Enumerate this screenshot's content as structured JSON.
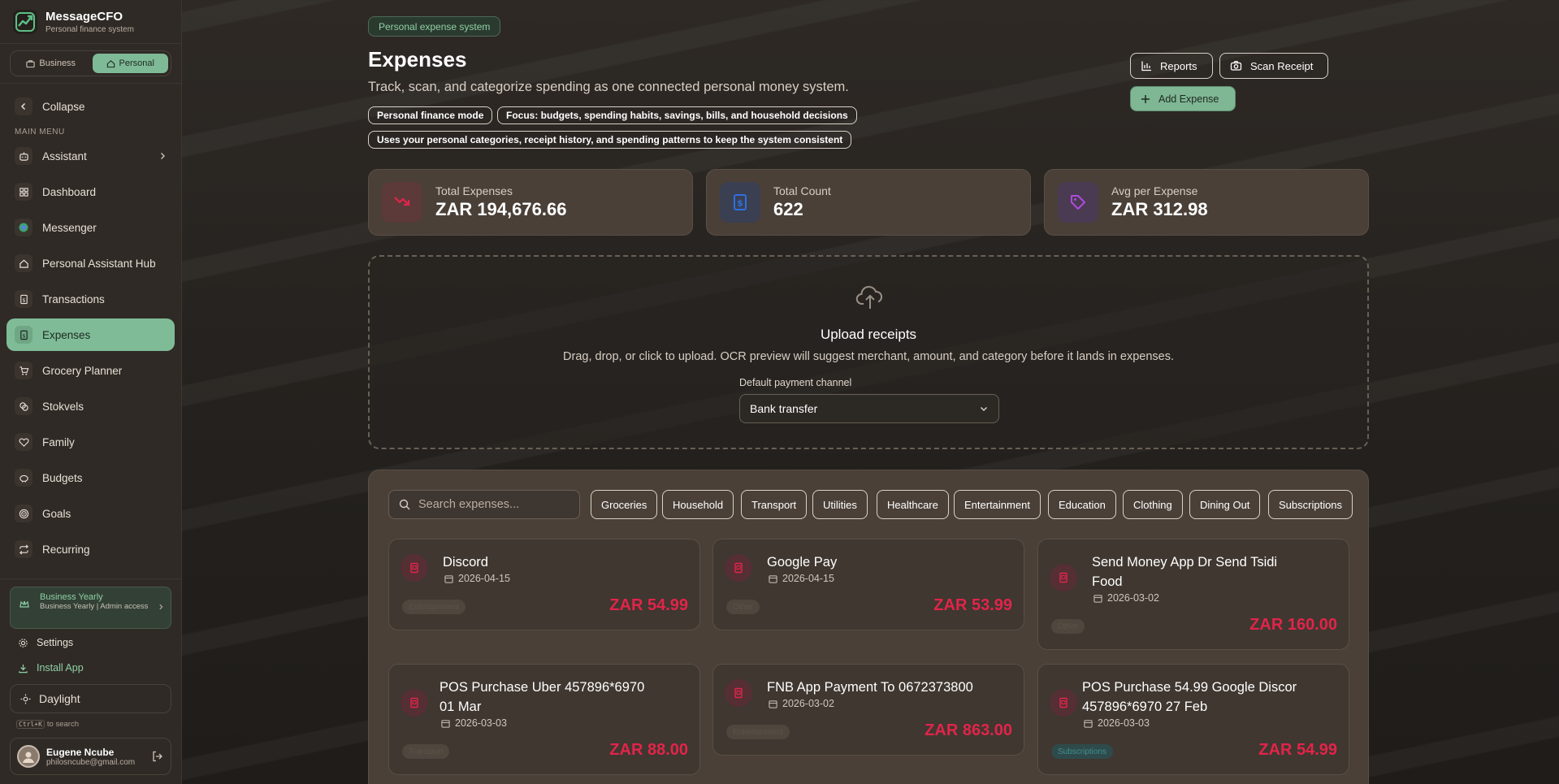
{
  "brand": {
    "name": "MessageCFO",
    "tagline": "Personal finance system"
  },
  "mode_toggle": {
    "business": "Business",
    "personal": "Personal",
    "active": "personal"
  },
  "sidebar": {
    "collapse": "Collapse",
    "menu_label": "MAIN MENU",
    "items": [
      {
        "label": "Assistant",
        "icon": "bot-icon"
      },
      {
        "label": "Dashboard",
        "icon": "grid-icon"
      },
      {
        "label": "Messenger",
        "icon": "whatsapp-icon"
      },
      {
        "label": "Personal Assistant Hub",
        "icon": "home-icon"
      },
      {
        "label": "Transactions",
        "icon": "receipt-icon"
      },
      {
        "label": "Expenses",
        "icon": "dollar-receipt-icon"
      },
      {
        "label": "Grocery Planner",
        "icon": "cart-icon"
      },
      {
        "label": "Stokvels",
        "icon": "coins-icon"
      },
      {
        "label": "Family",
        "icon": "heart-icon"
      },
      {
        "label": "Budgets",
        "icon": "piggy-bank-icon"
      },
      {
        "label": "Goals",
        "icon": "target-icon"
      },
      {
        "label": "Recurring",
        "icon": "repeat-icon"
      }
    ],
    "active_item": "Expenses",
    "plan": {
      "title": "Business Yearly",
      "subtitle": "Business Yearly | Admin access"
    },
    "settings": "Settings",
    "install": "Install App",
    "theme": "Daylight",
    "shortcut_key": "Ctrl+K",
    "shortcut_text": "to search",
    "user": {
      "name": "Eugene Ncube",
      "email": "philosncube@gmail.com"
    }
  },
  "header": {
    "system_pill": "Personal expense system",
    "title": "Expenses",
    "subtitle": "Track, scan, and categorize spending as one connected personal money system.",
    "tags": [
      "Personal finance mode",
      "Focus: budgets, spending habits, savings, bills, and household decisions",
      "Uses your personal categories, receipt history, and spending patterns to keep the system consistent"
    ],
    "reports_button": "Reports",
    "scan_button": "Scan Receipt",
    "add_button": "Add Expense"
  },
  "stats": [
    {
      "label": "Total Expenses",
      "value": "ZAR 194,676.66",
      "color": "#e2244a"
    },
    {
      "label": "Total Count",
      "value": "622",
      "color": "#2f6fe0"
    },
    {
      "label": "Avg per Expense",
      "value": "ZAR 312.98",
      "color": "#b04adf"
    }
  ],
  "upload": {
    "title": "Upload receipts",
    "description": "Drag, drop, or click to upload. OCR preview will suggest merchant, amount, and category before it lands in expenses.",
    "channel_label": "Default payment channel",
    "channel_value": "Bank transfer"
  },
  "search": {
    "placeholder": "Search expenses..."
  },
  "categories": [
    "Groceries",
    "Household",
    "Transport",
    "Utilities",
    "Healthcare",
    "Entertainment",
    "Education",
    "Clothing",
    "Dining Out",
    "Subscriptions"
  ],
  "expenses": [
    {
      "name": "Discord",
      "date": "2026-04-15",
      "amount": "ZAR 54.99",
      "category": "Entertainment"
    },
    {
      "name": "Google Pay",
      "date": "2026-04-15",
      "amount": "ZAR 53.99",
      "category": "Other"
    },
    {
      "name": "Send Money App Dr Send Tsidi Food",
      "date": "2026-03-02",
      "amount": "ZAR 160.00",
      "category": "Other"
    },
    {
      "name": "POS Purchase Uber 457896*6970 01 Mar",
      "date": "2026-03-03",
      "amount": "ZAR 88.00",
      "category": "Transport"
    },
    {
      "name": "FNB App Payment To 0672373800",
      "date": "2026-03-02",
      "amount": "ZAR 863.00",
      "category": "Entertainment"
    },
    {
      "name": "POS Purchase 54.99 Google Discor 457896*6970 27 Feb",
      "date": "2026-03-03",
      "amount": "ZAR 54.99",
      "category": "Subscriptions"
    }
  ],
  "accent_color": "#80bb98",
  "amount_color": "#e2244a"
}
